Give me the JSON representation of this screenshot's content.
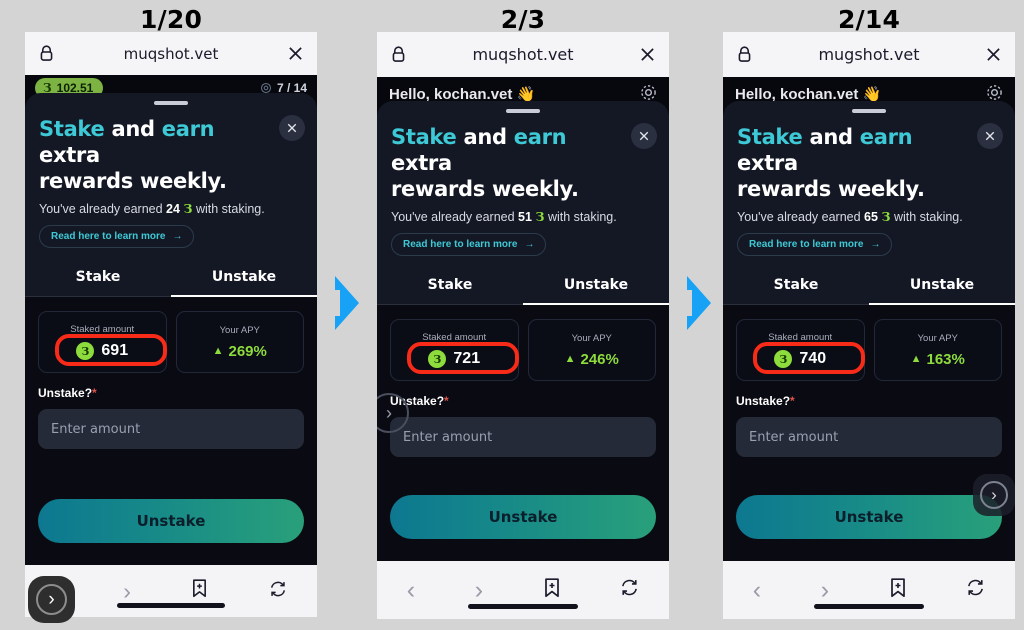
{
  "meta": {
    "background_color": "#d4d4d4",
    "accent_cyan": "#3ec9d6",
    "accent_green": "#8ddb3c",
    "highlight_red": "#f72b18",
    "step_arrow_color": "#17a2f5"
  },
  "shared": {
    "url": "muqshot.vet",
    "lock_icon": "lock-icon",
    "close_icon": "close-icon",
    "grabber": "sheet-grabber",
    "headline_part1": "Stake",
    "headline_part2": " and ",
    "headline_part3": "earn",
    "headline_part4": " extra",
    "headline_line2": "rewards weekly.",
    "subline_prefix": "You've already earned",
    "subline_suffix": "with staking.",
    "leaf_glyph": "З",
    "learn_more_label": "Read here to learn more",
    "learn_more_arrow": "→",
    "close_modal_icon": "close-modal-icon",
    "tab_stake": "Stake",
    "tab_unstake": "Unstake",
    "active_tab": "Unstake",
    "staked_label": "Staked amount",
    "apy_label": "Your APY",
    "apy_arrow": "▲",
    "token_glyph": "З",
    "field_label": "Unstake?",
    "field_required_marker": "*",
    "input_placeholder": "Enter amount",
    "input_value": "",
    "cta_label": "Unstake",
    "nav": {
      "back_icon": "chevron-left-icon",
      "forward_icon": "chevron-right-icon",
      "bookmark_icon": "bookmark-add-icon",
      "reload_icon": "reload-icon",
      "back_glyph": "‹",
      "forward_glyph": "›"
    },
    "float_arrow_glyph": "›"
  },
  "panels": [
    {
      "caption": "1/20",
      "url": "muqshot.vet",
      "earned": "24",
      "staked": "691",
      "apy": "269%",
      "backdrop_type": "balance",
      "balance_pill": "102.51",
      "shot_count": "7 / 14",
      "hello_text": "",
      "has_float_button": true,
      "has_ghost_button": false,
      "has_partial_ghost": false
    },
    {
      "caption": "2/3",
      "url": "muqshot.vet",
      "earned": "51",
      "staked": "721",
      "apy": "246%",
      "backdrop_type": "hello",
      "balance_pill": "",
      "shot_count": "",
      "hello_text": "Hello, kochan.vet",
      "hello_emoji": "👋",
      "settings_icon": "gear-icon",
      "has_float_button": false,
      "has_ghost_button": false,
      "has_partial_ghost": true
    },
    {
      "caption": "2/14",
      "url": "mugshot.vet",
      "earned": "65",
      "staked": "740",
      "apy": "163%",
      "backdrop_type": "hello",
      "balance_pill": "",
      "shot_count": "",
      "hello_text": "Hello, kochan.vet",
      "hello_emoji": "👋",
      "settings_icon": "gear-icon",
      "has_float_button": false,
      "has_ghost_button": true,
      "has_partial_ghost": false
    }
  ]
}
